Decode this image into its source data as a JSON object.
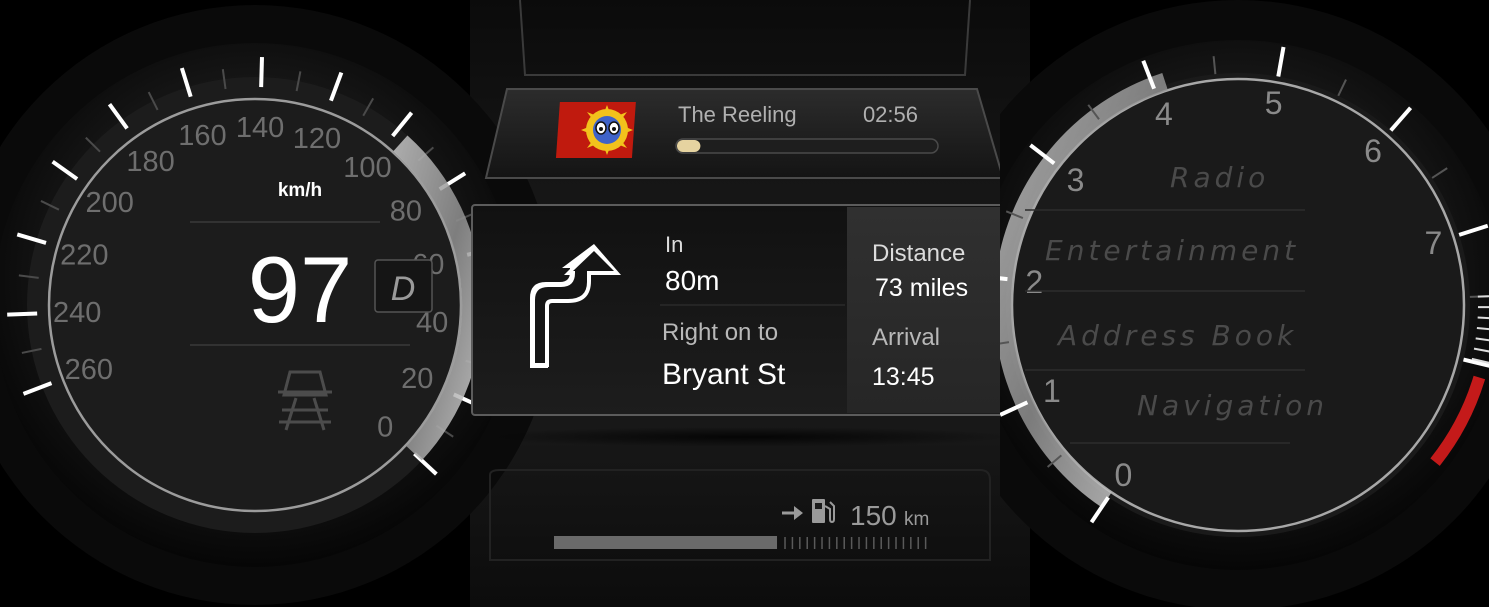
{
  "speedometer": {
    "speed": "97",
    "unit": "km/h",
    "gear": "D",
    "scale_labels": [
      "0",
      "20",
      "40",
      "60",
      "80",
      "100",
      "120",
      "140",
      "160",
      "180",
      "200",
      "220",
      "240",
      "260"
    ],
    "speed_value": 97
  },
  "media": {
    "title": "The Reeling",
    "time": "02:56",
    "progress": 0.09,
    "album_art_icon": "album-cover-icon"
  },
  "navigation": {
    "in_label": "In",
    "in_distance": "80m",
    "instruction": "Right on to",
    "street": "Bryant St",
    "distance_label": "Distance",
    "distance_value": "73 miles",
    "arrival_label": "Arrival",
    "arrival_value": "13:45",
    "turn_icon": "turn-right-then-left-icon"
  },
  "fuel": {
    "range": "150",
    "unit": "km",
    "level": 0.59,
    "icon": "fuel-pump-icon"
  },
  "tachometer": {
    "scale_labels": [
      "0",
      "1",
      "2",
      "3",
      "4",
      "5",
      "6",
      "7"
    ],
    "level": 4.1
  },
  "menu": {
    "items": [
      "Radio",
      "Entertainment",
      "Address Book",
      "Navigation"
    ]
  },
  "colors": {
    "accent_red": "#c41a1a",
    "progress_fill": "#e6d3a0",
    "text_white": "#ffffff",
    "label_grey": "#6e6e6e"
  }
}
